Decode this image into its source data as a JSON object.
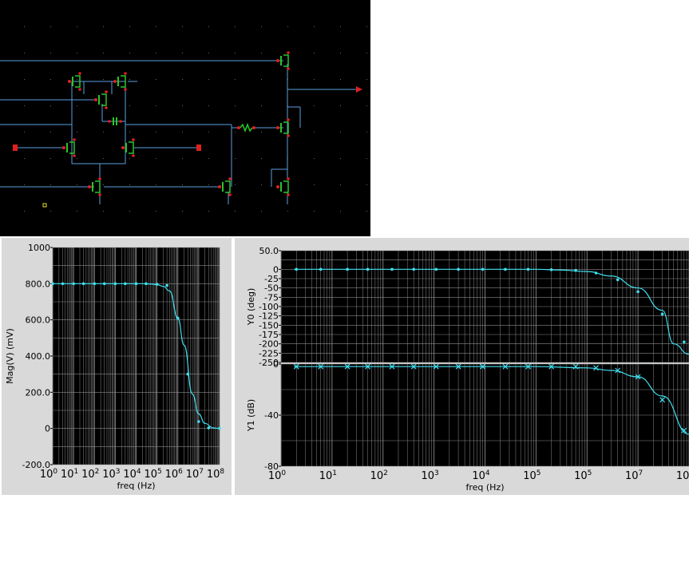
{
  "colors": {
    "wire": "#5aa0e0",
    "device": "#28c828",
    "pin": "#e02020",
    "plot_bg": "#000000",
    "grid": "#8a8a8a",
    "trace": "#40e0f0",
    "panel_bg": "#d9d9d9"
  },
  "icons": {
    "transistor": "transistor-icon",
    "resistor": "resistor-icon",
    "capacitor": "capacitor-icon",
    "input_pin": "input-pin-icon",
    "output_pin": "output-pin-icon"
  },
  "chart_data": [
    {
      "type": "line",
      "panel": "left",
      "xlabel": "freq (Hz)",
      "ylabel": "Mag(V) (mV)",
      "x_scale": "log",
      "xlim": [
        1,
        100000000
      ],
      "ylim": [
        -200,
        1000
      ],
      "x_ticks": [
        {
          "value": 1,
          "base": "10",
          "exp": "0"
        },
        {
          "value": 10,
          "base": "10",
          "exp": "1"
        },
        {
          "value": 100,
          "base": "10",
          "exp": "2"
        },
        {
          "value": 1000,
          "base": "10",
          "exp": "3"
        },
        {
          "value": 10000,
          "base": "10",
          "exp": "4"
        },
        {
          "value": 100000,
          "base": "10",
          "exp": "5"
        },
        {
          "value": 1000000,
          "base": "10",
          "exp": "6"
        },
        {
          "value": 10000000,
          "base": "10",
          "exp": "7"
        },
        {
          "value": 100000000,
          "base": "10",
          "exp": "8"
        }
      ],
      "y_ticks": [
        {
          "value": 1000,
          "label": "1000"
        },
        {
          "value": 800,
          "label": "800.0"
        },
        {
          "value": 600,
          "label": "600.0"
        },
        {
          "value": 400,
          "label": "400.0"
        },
        {
          "value": 200,
          "label": "200.0"
        },
        {
          "value": 0,
          "label": "0"
        },
        {
          "value": -200,
          "label": "-200.0"
        }
      ],
      "grid": true,
      "marker": "dot",
      "series": [
        {
          "x": [
            1,
            3,
            10,
            20,
            50,
            100,
            200,
            500,
            1000,
            2000,
            5000,
            10000,
            20000,
            50000,
            100000,
            200000,
            400000,
            1000000,
            2000000,
            5000000,
            10000000,
            20000000,
            50000000,
            100000000
          ],
          "y": [
            800,
            800,
            800,
            800,
            800,
            800,
            800,
            800,
            800,
            800,
            800,
            800,
            800,
            798,
            795,
            785,
            760,
            610,
            460,
            190,
            80,
            28,
            3,
            0
          ],
          "markers": [
            1,
            3,
            10,
            30,
            100,
            300,
            1000,
            3000,
            10000,
            30000,
            100000,
            300000,
            1000000,
            3000000,
            10000000,
            30000000,
            100000000
          ],
          "marker_y": [
            800,
            800,
            800,
            800,
            800,
            800,
            800,
            800,
            800,
            800,
            797,
            790,
            610,
            300,
            38,
            3,
            0
          ]
        }
      ]
    },
    {
      "type": "line",
      "panel": "right-top",
      "xlabel": "",
      "ylabel": "Y0 (deg)",
      "x_scale": "log",
      "xlim": [
        1,
        100000000
      ],
      "ylim": [
        -250,
        50
      ],
      "y_ticks": [
        {
          "value": 50,
          "label": "50.0"
        },
        {
          "value": 0,
          "label": "0"
        },
        {
          "value": -25,
          "label": "-25"
        },
        {
          "value": -50,
          "label": "-50"
        },
        {
          "value": -75,
          "label": "-75"
        },
        {
          "value": -100,
          "label": "-100"
        },
        {
          "value": -125,
          "label": "-125"
        },
        {
          "value": -150,
          "label": "-150"
        },
        {
          "value": -175,
          "label": "-175"
        },
        {
          "value": -200,
          "label": "-200"
        },
        {
          "value": -225,
          "label": "-225"
        },
        {
          "value": -250,
          "label": "-250"
        }
      ],
      "grid": true,
      "marker": "dot",
      "series": [
        {
          "x": [
            1.8,
            10,
            100,
            1000,
            10000,
            100000,
            300000,
            1000000,
            3000000,
            10000000,
            30000000,
            50000000,
            100000000,
            200000000
          ],
          "y": [
            0,
            0,
            0,
            0,
            0,
            0,
            -2,
            -6,
            -18,
            -50,
            -110,
            -200,
            -228,
            -195
          ],
          "markers": [
            2,
            6,
            20,
            50,
            150,
            400,
            1100,
            3000,
            9000,
            25000,
            70000,
            200000,
            600000,
            1500000,
            4000000,
            10000000,
            30000000,
            80000000,
            200000000
          ],
          "marker_y": [
            0,
            0,
            0,
            0,
            0,
            0,
            0,
            0,
            0,
            0,
            0,
            -1,
            -3,
            -10,
            -28,
            -60,
            -120,
            -195,
            -228
          ]
        }
      ]
    },
    {
      "type": "line",
      "panel": "right-bottom",
      "xlabel": "freq (Hz)",
      "ylabel": "Y1 (dB)",
      "x_scale": "log",
      "xlim": [
        1,
        100000000
      ],
      "ylim": [
        -80,
        0
      ],
      "x_ticks": [
        {
          "value": 1,
          "base": "10",
          "exp": "0"
        },
        {
          "value": 10,
          "base": "10",
          "exp": "1"
        },
        {
          "value": 100,
          "base": "10",
          "exp": "2"
        },
        {
          "value": 1000,
          "base": "10",
          "exp": "3"
        },
        {
          "value": 10000,
          "base": "10",
          "exp": "4"
        },
        {
          "value": 100000,
          "base": "10",
          "exp": "5"
        },
        {
          "value": 1000000,
          "base": "10",
          "exp": "5"
        },
        {
          "value": 10000000,
          "base": "10",
          "exp": "7"
        },
        {
          "value": 100000000,
          "base": "10",
          "exp": "8"
        }
      ],
      "y_ticks": [
        {
          "value": 0,
          "label": "0"
        },
        {
          "value": -40,
          "label": "-40"
        },
        {
          "value": -80,
          "label": "-80"
        }
      ],
      "grid": true,
      "marker": "x",
      "series": [
        {
          "x": [
            1.8,
            10,
            100,
            1000,
            10000,
            100000,
            1000000,
            3000000,
            10000000,
            30000000,
            100000000,
            200000000
          ],
          "y": [
            -2,
            -2,
            -2,
            -2,
            -2,
            -2,
            -3,
            -5,
            -10,
            -25,
            -55,
            -73
          ],
          "markers": [
            2,
            6,
            20,
            50,
            150,
            400,
            1100,
            3000,
            9000,
            25000,
            70000,
            200000,
            600000,
            1500000,
            4000000,
            10000000,
            30000000,
            80000000,
            200000000
          ],
          "marker_y": [
            -2,
            -2,
            -2,
            -2,
            -2,
            -2,
            -2,
            -2,
            -2,
            -2,
            -2,
            -2,
            -2,
            -3,
            -5,
            -10,
            -28,
            -52,
            -73
          ]
        }
      ]
    }
  ]
}
